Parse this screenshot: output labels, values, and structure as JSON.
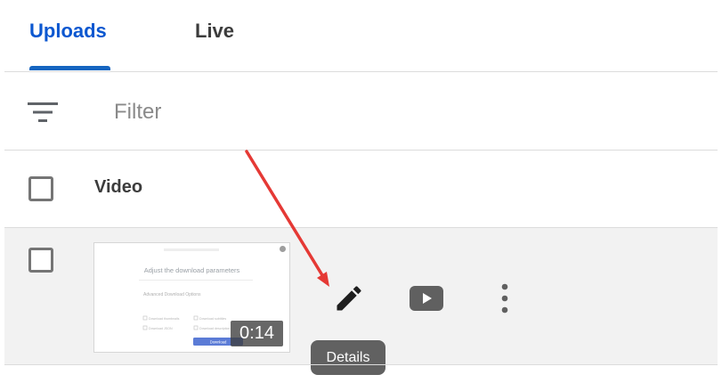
{
  "tabs": [
    {
      "label": "Uploads",
      "active": true
    },
    {
      "label": "Live",
      "active": false
    }
  ],
  "filter": {
    "placeholder": "Filter",
    "value": "",
    "icon": "filter-list-icon"
  },
  "table": {
    "header": {
      "column_label": "Video"
    },
    "rows": [
      {
        "thumbnail": {
          "title": "Adjust the download parameters",
          "section": "Advanced Download Options",
          "options": [
            "Download thumbnails",
            "Download subtitles",
            "Download JSON",
            "Download description"
          ],
          "button": "Download"
        },
        "duration": "0:14",
        "actions": {
          "details_icon": "pencil-icon",
          "watch_icon": "youtube-play-icon",
          "options_icon": "more-vert-icon"
        }
      }
    ]
  },
  "tooltip": {
    "label": "Details"
  },
  "colors": {
    "accent": "#0b57d0",
    "annotation_arrow": "#e53935",
    "tooltip_bg": "#616161"
  }
}
